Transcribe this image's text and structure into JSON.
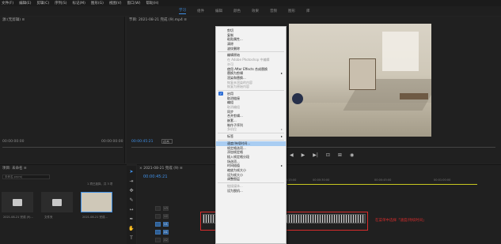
{
  "menubar": [
    "文件(F)",
    "编辑(E)",
    "剪辑(C)",
    "序列(S)",
    "标记(M)",
    "图形(G)",
    "视图(V)",
    "窗口(W)",
    "帮助(H)"
  ],
  "workspaces": [
    {
      "label": "学习",
      "active": true
    },
    {
      "label": "组件"
    },
    {
      "label": "编辑"
    },
    {
      "label": "颜色"
    },
    {
      "label": "效果"
    },
    {
      "label": "音频"
    },
    {
      "label": "图形"
    },
    {
      "label": "库"
    }
  ],
  "source": {
    "title": "源:(无剪辑) ≡",
    "timecode_left": "00:00:00:00",
    "timecode_right": "00:00:00:00"
  },
  "program": {
    "title": "节目: 2021-08-21 完成 (9).mp4 ≡",
    "timecode": "00:00:45:21",
    "fit": "适合"
  },
  "project": {
    "title": "项目: 未命名 ≡",
    "search_placeholder": "未命名.prproj",
    "count": "1 项已选择，共 3 项",
    "items": [
      {
        "label": "2021-08-21 完成 (9)...",
        "type": "folder"
      },
      {
        "label": "文件夹",
        "type": "folder"
      },
      {
        "label": "2021-08-21 完成...",
        "type": "video"
      }
    ]
  },
  "timeline": {
    "title": "× 2021-08-21 完成 (9) ≡",
    "timecode": "00:00:45:21",
    "ruler": [
      "00:00:15:00",
      "00:00:30:00",
      "00:00:45:00",
      "00:01:00:00"
    ],
    "tracks": [
      "V3",
      "V2",
      "V1",
      "A1",
      "A2",
      "A3"
    ]
  },
  "annotation": "在菜单中选择「速度/持续时间」",
  "context_menu": [
    {
      "label": "剪切",
      "disabled": false
    },
    {
      "label": "复制",
      "disabled": false
    },
    {
      "label": "粘贴属性...",
      "disabled": false
    },
    {
      "label": "清除",
      "disabled": false
    },
    {
      "label": "波纹删除",
      "disabled": false
    },
    {
      "sep": true
    },
    {
      "label": "编辑原始",
      "disabled": false
    },
    {
      "label": "在 Adobe Photoshop 中编辑",
      "disabled": true
    },
    {
      "label": "许可",
      "disabled": true
    },
    {
      "label": "使用 After Effects 合成替换",
      "disabled": false
    },
    {
      "label": "替换为剪辑",
      "disabled": false,
      "submenu": true
    },
    {
      "label": "渲染和替换...",
      "disabled": false
    },
    {
      "label": "恢复未渲染的内容",
      "disabled": true
    },
    {
      "label": "恢复为原始内容",
      "disabled": true
    },
    {
      "sep": true
    },
    {
      "label": "启用",
      "disabled": false,
      "checked": true
    },
    {
      "label": "取消链接",
      "disabled": false
    },
    {
      "label": "编组",
      "disabled": false
    },
    {
      "label": "取消编组",
      "disabled": true
    },
    {
      "label": "同步",
      "disabled": false
    },
    {
      "label": "合并剪辑...",
      "disabled": false
    },
    {
      "label": "嵌套...",
      "disabled": false
    },
    {
      "label": "制作子序列",
      "disabled": false
    },
    {
      "label": "多机位",
      "disabled": true,
      "submenu": true
    },
    {
      "sep": true
    },
    {
      "label": "标签",
      "disabled": false,
      "submenu": true
    },
    {
      "sep": true
    },
    {
      "label": "速度/持续时间...",
      "disabled": false,
      "highlighted": true
    },
    {
      "label": "帧定格选项...",
      "disabled": false
    },
    {
      "label": "添加帧定格",
      "disabled": false
    },
    {
      "label": "插入帧定格分段",
      "disabled": false
    },
    {
      "label": "场选项...",
      "disabled": false
    },
    {
      "label": "时间插值",
      "disabled": false,
      "submenu": true
    },
    {
      "label": "缩放为帧大小",
      "disabled": false
    },
    {
      "label": "设为帧大小",
      "disabled": false
    },
    {
      "label": "调整图层",
      "disabled": false
    },
    {
      "sep": true
    },
    {
      "label": "链接媒体...",
      "disabled": true
    },
    {
      "label": "设为脱机...",
      "disabled": false
    }
  ],
  "colors": {
    "accent": "#3f8fe6",
    "highlight": "#a9cdf2",
    "annotation_red": "#d82c2c"
  }
}
